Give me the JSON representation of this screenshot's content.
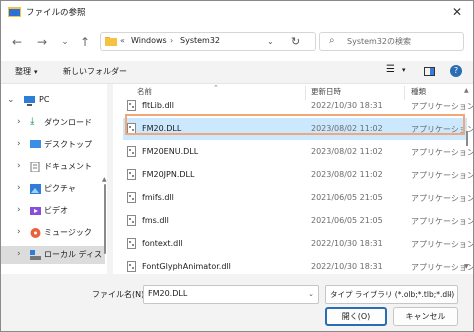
{
  "window": {
    "title": "ファイルの参照"
  },
  "nav": {
    "breadcrumb_prefix": "«",
    "breadcrumbs": [
      "Windows",
      "System32"
    ],
    "crumb_sep": "›",
    "search_placeholder": "System32の検索"
  },
  "toolbar": {
    "organize": "整理",
    "new_folder": "新しいフォルダー"
  },
  "sidebar": {
    "items": [
      {
        "label": "PC"
      },
      {
        "label": "ダウンロード"
      },
      {
        "label": "デスクトップ"
      },
      {
        "label": "ドキュメント"
      },
      {
        "label": "ピクチャ"
      },
      {
        "label": "ビデオ"
      },
      {
        "label": "ミュージック"
      },
      {
        "label": "ローカル ディスク (C"
      }
    ]
  },
  "columns": {
    "name": "名前",
    "date": "更新日時",
    "type": "種類"
  },
  "files": [
    {
      "name": "fltLib.dll",
      "date": "2022/10/30 18:31",
      "type": "アプリケーション"
    },
    {
      "name": "FM20.DLL",
      "date": "2023/08/02 11:02",
      "type": "アプリケーション"
    },
    {
      "name": "FM20ENU.DLL",
      "date": "2023/08/02 11:02",
      "type": "アプリケーション"
    },
    {
      "name": "FM20JPN.DLL",
      "date": "2023/08/02 11:02",
      "type": "アプリケーション"
    },
    {
      "name": "fmifs.dll",
      "date": "2021/06/05 21:05",
      "type": "アプリケーション"
    },
    {
      "name": "fms.dll",
      "date": "2021/06/05 21:05",
      "type": "アプリケーション"
    },
    {
      "name": "fontext.dll",
      "date": "2022/10/30 18:31",
      "type": "アプリケーション"
    },
    {
      "name": "FontGlyphAnimator.dll",
      "date": "2022/10/30 18:31",
      "type": "アプリケーション"
    }
  ],
  "bottom": {
    "filename_label": "ファイル名(N):",
    "filename_value": "FM20.DLL",
    "filter_value": "タイプ ライブラリ (*.olb;*.tlb;*.dll)",
    "open_button": "開く(O)",
    "cancel_button": "キャンセル"
  },
  "colors": {
    "selection": "#cce8ff",
    "highlight_outline": "#f0a878",
    "primary_border": "#2a6db3"
  }
}
